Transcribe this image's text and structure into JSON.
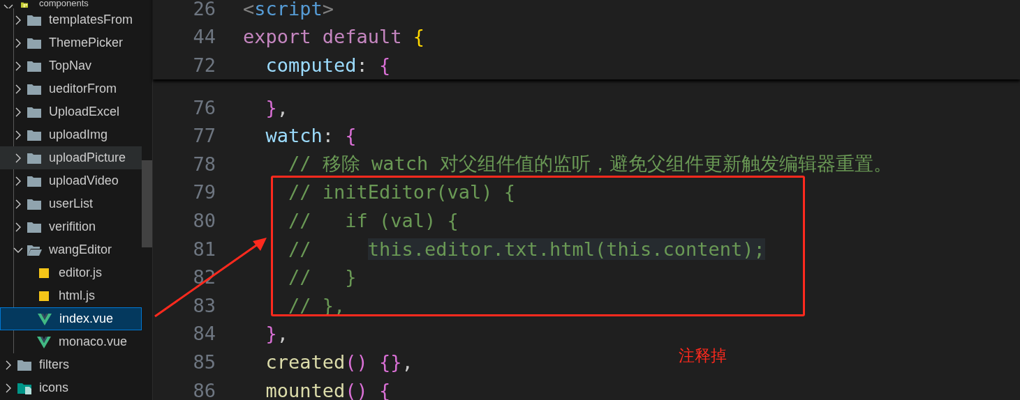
{
  "explorer": {
    "items": [
      {
        "label": "components",
        "kind": "library",
        "expanded": true,
        "selected": false,
        "hovered": false,
        "children": [
          {
            "label": "templatesFrom",
            "kind": "folder",
            "expanded": false,
            "selected": false,
            "hovered": false
          },
          {
            "label": "ThemePicker",
            "kind": "folder",
            "expanded": false,
            "selected": false,
            "hovered": false
          },
          {
            "label": "TopNav",
            "kind": "folder",
            "expanded": false,
            "selected": false,
            "hovered": false
          },
          {
            "label": "ueditorFrom",
            "kind": "folder",
            "expanded": false,
            "selected": false,
            "hovered": false
          },
          {
            "label": "UploadExcel",
            "kind": "folder",
            "expanded": false,
            "selected": false,
            "hovered": false
          },
          {
            "label": "uploadImg",
            "kind": "folder",
            "expanded": false,
            "selected": false,
            "hovered": false
          },
          {
            "label": "uploadPicture",
            "kind": "folder",
            "expanded": false,
            "selected": false,
            "hovered": true
          },
          {
            "label": "uploadVideo",
            "kind": "folder",
            "expanded": false,
            "selected": false,
            "hovered": false
          },
          {
            "label": "userList",
            "kind": "folder",
            "expanded": false,
            "selected": false,
            "hovered": false
          },
          {
            "label": "verifition",
            "kind": "folder",
            "expanded": false,
            "selected": false,
            "hovered": false
          },
          {
            "label": "wangEditor",
            "kind": "folder",
            "expanded": true,
            "selected": false,
            "hovered": false,
            "children": [
              {
                "label": "editor.js",
                "kind": "js",
                "selected": false,
                "hovered": false
              },
              {
                "label": "html.js",
                "kind": "js",
                "selected": false,
                "hovered": false
              },
              {
                "label": "index.vue",
                "kind": "vue",
                "selected": true,
                "hovered": false
              },
              {
                "label": "monaco.vue",
                "kind": "vue",
                "selected": false,
                "hovered": false
              }
            ]
          }
        ]
      },
      {
        "label": "filters",
        "kind": "folder",
        "expanded": false,
        "selected": false,
        "hovered": false
      },
      {
        "label": "icons",
        "kind": "media",
        "expanded": false,
        "selected": false,
        "hovered": false
      }
    ]
  },
  "editor": {
    "sticky_lines": [
      {
        "number": "26",
        "tokens": [
          {
            "text": "<",
            "kind": "bracket"
          },
          {
            "text": "script",
            "kind": "tag"
          },
          {
            "text": ">",
            "kind": "bracket"
          }
        ]
      },
      {
        "number": "44",
        "tokens": [
          {
            "text": "export default ",
            "kind": "keyword"
          },
          {
            "text": "{",
            "kind": "brace1"
          }
        ]
      },
      {
        "number": "72",
        "tokens": [
          {
            "text": "  computed",
            "kind": "property"
          },
          {
            "text": ": ",
            "kind": "plain"
          },
          {
            "text": "{",
            "kind": "brace2"
          }
        ]
      }
    ],
    "lines": [
      {
        "number": "76",
        "tokens": [
          {
            "text": "  }",
            "kind": "brace2"
          },
          {
            "text": ",",
            "kind": "plain"
          }
        ]
      },
      {
        "number": "77",
        "tokens": [
          {
            "text": "  watch",
            "kind": "property"
          },
          {
            "text": ": ",
            "kind": "plain"
          },
          {
            "text": "{",
            "kind": "brace2"
          }
        ]
      },
      {
        "number": "78",
        "tokens": [
          {
            "text": "    // 移除 watch 对父组件值的监听，避免父组件更新触发编辑器重置。",
            "kind": "comment"
          }
        ]
      },
      {
        "number": "79",
        "tokens": [
          {
            "text": "    // initEditor(val) {",
            "kind": "comment"
          }
        ]
      },
      {
        "number": "80",
        "tokens": [
          {
            "text": "    //   if (val) {",
            "kind": "comment"
          }
        ]
      },
      {
        "number": "81",
        "tokens": [
          {
            "text": "    //     ",
            "kind": "comment"
          },
          {
            "text": "this.editor.txt.html(this.content);",
            "kind": "comment",
            "highlighted": true
          }
        ]
      },
      {
        "number": "82",
        "tokens": [
          {
            "text": "    //   }",
            "kind": "comment"
          }
        ]
      },
      {
        "number": "83",
        "tokens": [
          {
            "text": "    // },",
            "kind": "comment"
          }
        ]
      },
      {
        "number": "84",
        "tokens": [
          {
            "text": "  }",
            "kind": "brace2"
          },
          {
            "text": ",",
            "kind": "plain"
          }
        ]
      },
      {
        "number": "85",
        "tokens": [
          {
            "text": "  created",
            "kind": "function"
          },
          {
            "text": "()",
            "kind": "brace2"
          },
          {
            "text": " {}",
            "kind": "brace2"
          },
          {
            "text": ",",
            "kind": "plain"
          }
        ]
      },
      {
        "number": "86",
        "tokens": [
          {
            "text": "  mounted",
            "kind": "function"
          },
          {
            "text": "()",
            "kind": "brace2"
          },
          {
            "text": " {",
            "kind": "brace2"
          }
        ]
      }
    ]
  },
  "annotation_note": "注释掉"
}
